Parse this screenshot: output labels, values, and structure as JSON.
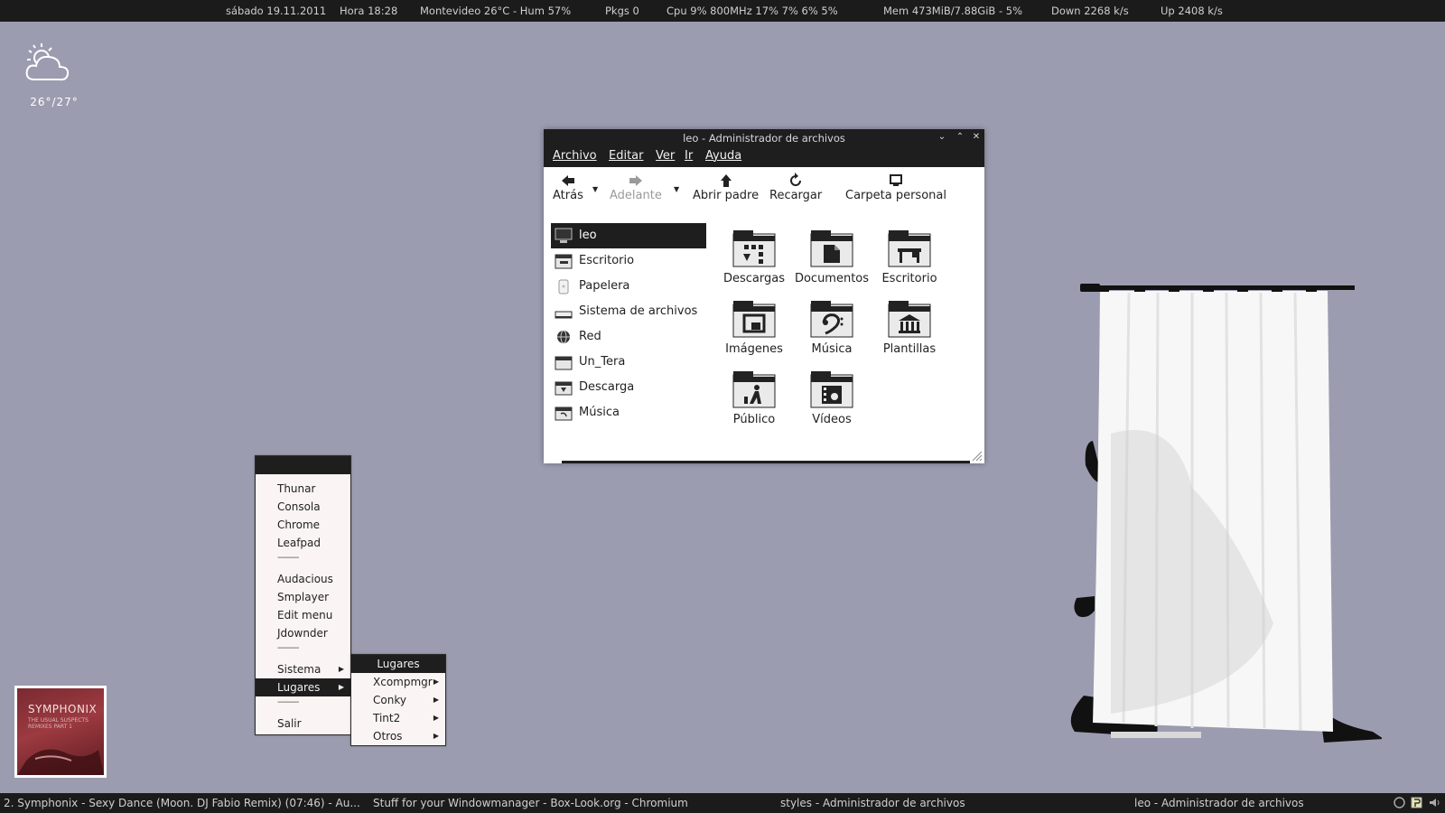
{
  "topbar": {
    "date": "sábado  19.11.2011",
    "time": "Hora  18:28",
    "weather": "Montevideo  26°C -  Hum 57%",
    "pkgs": "Pkgs 0",
    "cpu": "Cpu 9%  800MHz  17%  7%  6%   5%",
    "mem": "Mem  473MiB/7.88GiB - 5%",
    "down": "Down  2268  k/s",
    "up": "Up  2408  k/s"
  },
  "weather_widget": {
    "temp": "26°/27°",
    "icon": "partly-cloudy-icon"
  },
  "file_manager": {
    "title": "leo - Administrador de archivos",
    "window_buttons": [
      "⌄",
      "⌃",
      "✕"
    ],
    "menu": [
      "Archivo",
      "Editar",
      "Ver",
      "Ir",
      "Ayuda"
    ],
    "toolbar": {
      "back": "Atrás",
      "forward": "Adelante",
      "parent": "Abrir padre",
      "reload": "Recargar",
      "home": "Carpeta personal"
    },
    "sidebar": [
      {
        "label": "leo",
        "icon": "monitor-icon",
        "selected": true
      },
      {
        "label": "Escritorio",
        "icon": "desktop-folder-icon"
      },
      {
        "label": "Papelera",
        "icon": "trash-icon"
      },
      {
        "label": "Sistema de archivos",
        "icon": "drive-icon"
      },
      {
        "label": "Red",
        "icon": "network-globe-icon"
      },
      {
        "label": "Un_Tera",
        "icon": "folder-icon"
      },
      {
        "label": "Descarga",
        "icon": "downloads-folder-icon"
      },
      {
        "label": "Música",
        "icon": "music-folder-icon"
      }
    ],
    "files": [
      {
        "label": "Descargas",
        "icon": "downloads-folder-icon"
      },
      {
        "label": "Documentos",
        "icon": "documents-folder-icon"
      },
      {
        "label": "Escritorio",
        "icon": "desktop-folder-icon"
      },
      {
        "label": "Imágenes",
        "icon": "pictures-folder-icon"
      },
      {
        "label": "Música",
        "icon": "music-folder-icon"
      },
      {
        "label": "Plantillas",
        "icon": "templates-folder-icon"
      },
      {
        "label": "Público",
        "icon": "public-folder-icon"
      },
      {
        "label": "Vídeos",
        "icon": "videos-folder-icon"
      }
    ]
  },
  "main_menu": {
    "items": [
      {
        "label": "Thunar"
      },
      {
        "label": "Consola"
      },
      {
        "label": "Chrome"
      },
      {
        "label": "Leafpad"
      },
      {
        "separator": "---------"
      },
      {
        "label": "Audacious"
      },
      {
        "label": "Smplayer"
      },
      {
        "label": "Edit menu"
      },
      {
        "label": "Jdownder"
      },
      {
        "separator": "---------"
      },
      {
        "label": "Sistema",
        "submenu": true
      },
      {
        "label": "Lugares",
        "submenu": true,
        "active": true
      },
      {
        "separator": "---------"
      },
      {
        "label": "Salir"
      }
    ]
  },
  "sub_menu": {
    "title": "Lugares",
    "items": [
      {
        "label": "Xcompmgr",
        "submenu": true
      },
      {
        "label": "Conky",
        "submenu": true
      },
      {
        "label": "Tint2",
        "submenu": true
      },
      {
        "label": "Otros",
        "submenu": true
      }
    ]
  },
  "album_art": {
    "title": "SYMPHONIX",
    "subtitle": "THE USUAL SUSPECTS\nREMIXES PART 1"
  },
  "taskbar": {
    "tasks": [
      "2. Symphonix - Sexy Dance (Moon. DJ Fabio Remix) (07:46) - Au...",
      "Stuff for your Windowmanager - Box-Look.org - Chromium",
      "styles - Administrador de archivos",
      "leo - Administrador de archivos"
    ]
  },
  "colors": {
    "desktop": "#9c9cb0",
    "bar": "#1b1b1b",
    "menu_bg": "#fbf4f4",
    "selection": "#1e1e1e"
  }
}
